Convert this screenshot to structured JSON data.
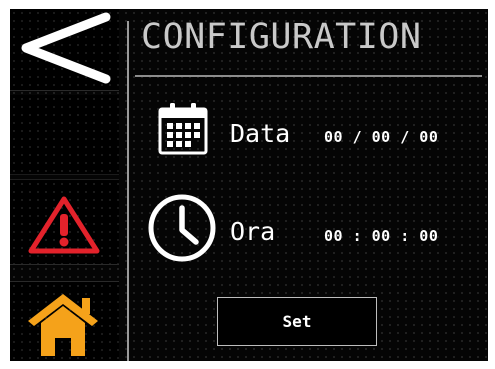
{
  "header": {
    "title": "CONFIGURATION"
  },
  "sidebar": {
    "items": [
      {
        "icon": "back-arrow-icon"
      },
      {
        "icon": ""
      },
      {
        "icon": "warning-icon",
        "color": "#e3222b"
      },
      {
        "icon": "home-icon",
        "color": "#f5a21a"
      }
    ]
  },
  "date_row": {
    "icon": "calendar-icon",
    "label": "Data",
    "value": "00 / 00 / 00"
  },
  "time_row": {
    "icon": "clock-icon",
    "label": "Ora",
    "value": "00 : 00 : 00"
  },
  "actions": {
    "set_label": "Set"
  },
  "colors": {
    "background": "#050505",
    "title_text": "#c9c9c9",
    "divider": "#8d8d8d"
  }
}
